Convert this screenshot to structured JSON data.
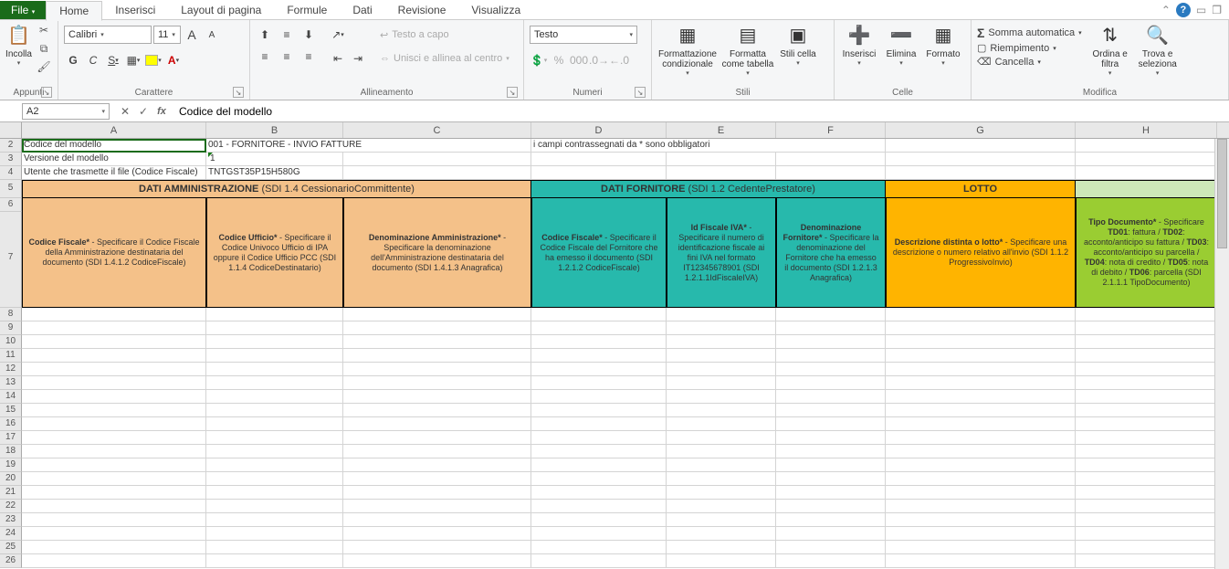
{
  "tabs": {
    "file": "File",
    "list": [
      "Home",
      "Inserisci",
      "Layout di pagina",
      "Formule",
      "Dati",
      "Revisione",
      "Visualizza"
    ],
    "active": 0
  },
  "ribbon": {
    "clipboard": {
      "paste": "Incolla",
      "label": "Appunti"
    },
    "font": {
      "name": "Calibri",
      "size": "11",
      "grow": "A",
      "shrink": "A",
      "bold": "G",
      "italic": "C",
      "underline": "S",
      "label": "Carattere"
    },
    "alignment": {
      "wrap": "Testo a capo",
      "merge": "Unisci e allinea al centro",
      "label": "Allineamento"
    },
    "number": {
      "format": "Testo",
      "label": "Numeri"
    },
    "styles": {
      "condfmt": "Formattazione condizionale",
      "table": "Formatta come tabella",
      "cell": "Stili cella",
      "label": "Stili"
    },
    "cells": {
      "insert": "Inserisci",
      "delete": "Elimina",
      "format": "Formato",
      "label": "Celle"
    },
    "editing": {
      "sum": "Somma automatica",
      "fill": "Riempimento",
      "clear": "Cancella",
      "sort": "Ordina e filtra",
      "find": "Trova e seleziona",
      "label": "Modifica"
    }
  },
  "namebox": "A2",
  "formula": "Codice del modello",
  "columns": [
    "A",
    "B",
    "C",
    "D",
    "E",
    "F",
    "G",
    "H"
  ],
  "rows": {
    "r2": {
      "A": "Codice del modello",
      "B": "001 - FORNITORE - INVIO FATTURE",
      "D": "i campi contrassegnati da * sono obbligatori"
    },
    "r3": {
      "A": "Versione del modello",
      "B": "1"
    },
    "r4": {
      "A": "Utente che trasmette il file (Codice Fiscale)",
      "B": "TNTGST35P15H580G"
    }
  },
  "sections": {
    "admin": {
      "title": "DATI AMMINISTRAZIONE",
      "sub": " (SDI 1.4 CessionarioCommittente)"
    },
    "forn": {
      "title": "DATI FORNITORE",
      "sub": " (SDI 1.2 CedentePrestatore)"
    },
    "lotto": "LOTTO"
  },
  "headers": {
    "A": {
      "title": "Codice Fiscale*",
      "desc": "  - Specificare il Codice Fiscale della Amministrazione destinataria del documento (SDI 1.4.1.2 CodiceFiscale)"
    },
    "B": {
      "title": "Codice Ufficio*",
      "desc": " - Specificare il Codice Univoco Ufficio di IPA oppure il Codice Ufficio PCC (SDI  1.1.4 CodiceDestinatario)"
    },
    "C": {
      "title": "Denominazione Amministrazione*",
      "desc": " - Specificare la denominazione dell'Amministrazione destinataria del documento (SDI 1.4.1.3 Anagrafica)"
    },
    "D": {
      "title": "Codice Fiscale*",
      "desc": " - Specificare il Codice Fiscale del Fornitore che ha emesso il documento (SDI 1.2.1.2 CodiceFiscale)"
    },
    "E": {
      "title": "Id Fiscale IVA*",
      "desc": " - Specificare il numero di identificazione fiscale ai fini IVA nel formato IT12345678901 (SDI 1.2.1.1IdFiscaleIVA)"
    },
    "F": {
      "title": "Denominazione Fornitore*",
      "desc": " - Specificare la denominazione del Fornitore che ha emesso il documento (SDI 1.2.1.3 Anagrafica)"
    },
    "G": {
      "title": "Descrizione distinta o lotto*",
      "desc": " - Specificare una descrizione o numero relativo all'invio  (SDI 1.1.2 ProgressivoInvio)"
    },
    "H": {
      "title": "Tipo Documento*",
      "desc1": " - Specificare ",
      "b1": "TD01",
      "t1": ": fattura / ",
      "b2": "TD02",
      "t2": ": acconto/anticipo su fattura / ",
      "b3": "TD03",
      "t3": ": acconto/anticipo su parcella / ",
      "b4": "TD04",
      "t4": ": nota di credito / ",
      "b5": "TD05",
      "t5": ": nota di debito / ",
      "b6": "TD06",
      "t6": ": parcella (SDI 2.1.1.1 TipoDocumento)"
    }
  },
  "empty_rows": [
    8,
    9,
    10,
    11,
    12,
    13,
    14,
    15,
    16,
    17,
    18,
    19,
    20,
    21,
    22,
    23,
    24,
    25,
    26
  ]
}
